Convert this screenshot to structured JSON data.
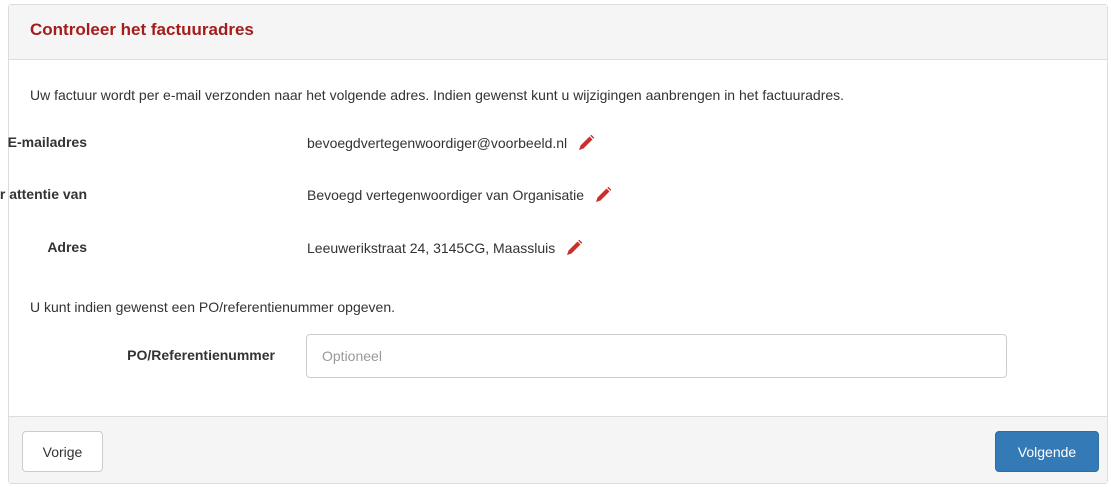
{
  "header": {
    "title": "Controleer het factuuradres"
  },
  "intro_text": "Uw factuur wordt per e-mail verzonden naar het volgende adres. Indien gewenst kunt u wijzigingen aanbrengen in het factuuradres.",
  "fields": [
    {
      "label": "E-mailadres",
      "value": "bevoegdvertegenwoordiger@voorbeeld.nl",
      "icon": "pencil-icon"
    },
    {
      "label": "Ter attentie van",
      "value": "Bevoegd vertegenwoordiger van Organisatie",
      "icon": "pencil-icon"
    },
    {
      "label": "Adres",
      "value": "Leeuwerikstraat 24, 3145CG, Maassluis",
      "icon": "pencil-icon"
    }
  ],
  "po": {
    "intro": "U kunt indien gewenst een PO/referentienummer opgeven.",
    "label": "PO/Referentienummer",
    "value": "",
    "placeholder": "Optioneel"
  },
  "footer": {
    "prev_label": "Vorige",
    "next_label": "Volgende"
  },
  "colors": {
    "title": "#a31d1d",
    "edit_icon": "#c9302c",
    "primary_button": "#337ab7"
  }
}
